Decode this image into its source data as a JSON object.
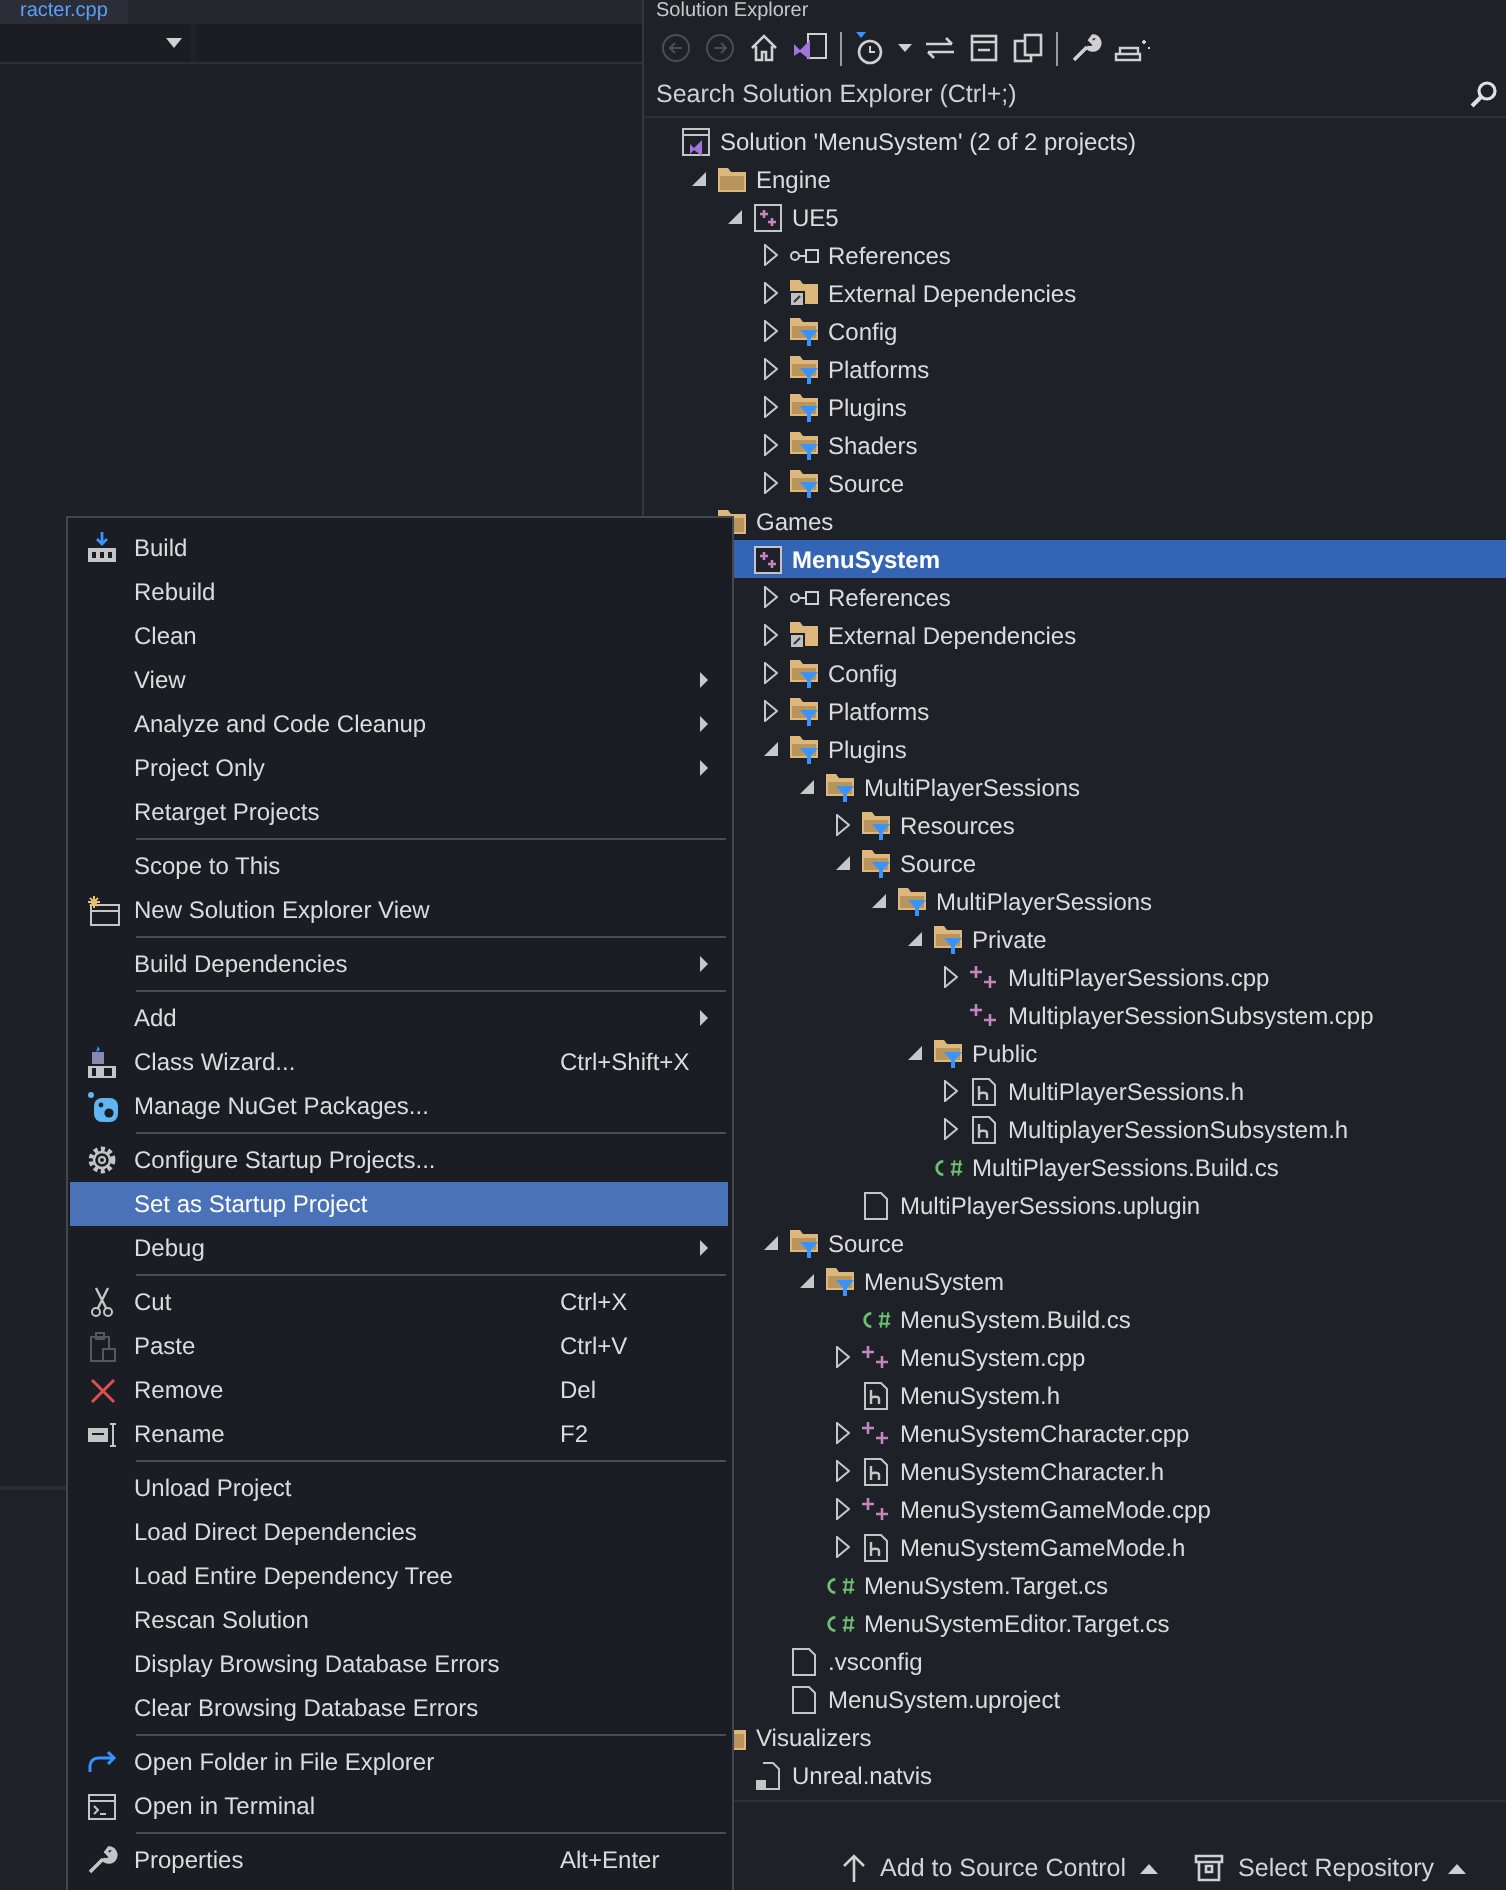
{
  "editor": {
    "tab": "racter.cpp"
  },
  "explorer": {
    "title": "Solution Explorer",
    "search": {
      "placeholder": "Search Solution Explorer (Ctrl+;)"
    },
    "tree": [
      {
        "label": "Solution 'MenuSystem' (2 of 2 projects)",
        "kind": "solution",
        "selected": false,
        "children": [
          {
            "label": "Engine",
            "kind": "folder",
            "expanded": true,
            "selected": false,
            "children": [
              {
                "label": "UE5",
                "kind": "project",
                "expanded": true,
                "selected": false,
                "children": [
                  {
                    "label": "References",
                    "kind": "references",
                    "expanded": false,
                    "selected": false
                  },
                  {
                    "label": "External Dependencies",
                    "kind": "deps",
                    "expanded": false,
                    "selected": false
                  },
                  {
                    "label": "Config",
                    "kind": "filter",
                    "expanded": false,
                    "selected": false
                  },
                  {
                    "label": "Platforms",
                    "kind": "filter",
                    "expanded": false,
                    "selected": false
                  },
                  {
                    "label": "Plugins",
                    "kind": "filter",
                    "expanded": false,
                    "selected": false
                  },
                  {
                    "label": "Shaders",
                    "kind": "filter",
                    "expanded": false,
                    "selected": false
                  },
                  {
                    "label": "Source",
                    "kind": "filter",
                    "expanded": false,
                    "selected": false
                  }
                ]
              }
            ]
          },
          {
            "label": "Games",
            "kind": "folder",
            "selected": false,
            "children": [
              {
                "label": "MenuSystem",
                "kind": "project",
                "selected": true,
                "children": [
                  {
                    "label": "References",
                    "kind": "references",
                    "expanded": false,
                    "selected": false
                  },
                  {
                    "label": "External Dependencies",
                    "kind": "deps",
                    "expanded": false,
                    "selected": false
                  },
                  {
                    "label": "Config",
                    "kind": "filter",
                    "expanded": false,
                    "selected": false
                  },
                  {
                    "label": "Platforms",
                    "kind": "filter",
                    "expanded": false,
                    "selected": false
                  },
                  {
                    "label": "Plugins",
                    "kind": "filter",
                    "expanded": true,
                    "selected": false,
                    "children": [
                      {
                        "label": "MultiPlayerSessions",
                        "kind": "filter",
                        "expanded": true,
                        "selected": false,
                        "children": [
                          {
                            "label": "Resources",
                            "kind": "filter",
                            "expanded": false,
                            "selected": false
                          },
                          {
                            "label": "Source",
                            "kind": "filter",
                            "expanded": true,
                            "selected": false,
                            "children": [
                              {
                                "label": "MultiPlayerSessions",
                                "kind": "filter",
                                "expanded": true,
                                "selected": false,
                                "children": [
                                  {
                                    "label": "Private",
                                    "kind": "filter",
                                    "expanded": true,
                                    "selected": false,
                                    "children": [
                                      {
                                        "label": "MultiPlayerSessions.cpp",
                                        "kind": "cpp",
                                        "expanded": false,
                                        "selected": false
                                      },
                                      {
                                        "label": "MultiplayerSessionSubsystem.cpp",
                                        "kind": "cpp",
                                        "selected": false
                                      }
                                    ]
                                  },
                                  {
                                    "label": "Public",
                                    "kind": "filter",
                                    "expanded": true,
                                    "selected": false,
                                    "children": [
                                      {
                                        "label": "MultiPlayerSessions.h",
                                        "kind": "h",
                                        "expanded": false,
                                        "selected": false
                                      },
                                      {
                                        "label": "MultiplayerSessionSubsystem.h",
                                        "kind": "h",
                                        "expanded": false,
                                        "selected": false
                                      }
                                    ]
                                  },
                                  {
                                    "label": "MultiPlayerSessions.Build.cs",
                                    "kind": "cs",
                                    "selected": false
                                  }
                                ]
                              }
                            ]
                          },
                          {
                            "label": "MultiPlayerSessions.uplugin",
                            "kind": "file",
                            "selected": false
                          }
                        ]
                      }
                    ]
                  },
                  {
                    "label": "Source",
                    "kind": "filter",
                    "expanded": true,
                    "selected": false,
                    "children": [
                      {
                        "label": "MenuSystem",
                        "kind": "filter",
                        "expanded": true,
                        "selected": false,
                        "children": [
                          {
                            "label": "MenuSystem.Build.cs",
                            "kind": "cs",
                            "selected": false
                          },
                          {
                            "label": "MenuSystem.cpp",
                            "kind": "cpp",
                            "expanded": false,
                            "selected": false
                          },
                          {
                            "label": "MenuSystem.h",
                            "kind": "h",
                            "selected": false
                          },
                          {
                            "label": "MenuSystemCharacter.cpp",
                            "kind": "cpp",
                            "expanded": false,
                            "selected": false
                          },
                          {
                            "label": "MenuSystemCharacter.h",
                            "kind": "h",
                            "expanded": false,
                            "selected": false
                          },
                          {
                            "label": "MenuSystemGameMode.cpp",
                            "kind": "cpp",
                            "expanded": false,
                            "selected": false
                          },
                          {
                            "label": "MenuSystemGameMode.h",
                            "kind": "h",
                            "expanded": false,
                            "selected": false
                          }
                        ]
                      },
                      {
                        "label": "MenuSystem.Target.cs",
                        "kind": "cs",
                        "selected": false
                      },
                      {
                        "label": "MenuSystemEditor.Target.cs",
                        "kind": "cs",
                        "selected": false
                      }
                    ]
                  },
                  {
                    "label": ".vsconfig",
                    "kind": "file",
                    "selected": false
                  },
                  {
                    "label": "MenuSystem.uproject",
                    "kind": "file",
                    "selected": false
                  }
                ]
              }
            ]
          },
          {
            "label": "Visualizers",
            "kind": "folder",
            "selected": false,
            "children": [
              {
                "label": "Unreal.natvis",
                "kind": "natvis",
                "selected": false
              }
            ]
          }
        ]
      }
    ]
  },
  "context_menu": [
    {
      "kind": "item",
      "label": "Build",
      "submenu": false,
      "selected": false
    },
    {
      "kind": "item",
      "label": "Rebuild",
      "submenu": false,
      "selected": false
    },
    {
      "kind": "item",
      "label": "Clean",
      "submenu": false,
      "selected": false
    },
    {
      "kind": "item",
      "label": "View",
      "submenu": true,
      "selected": false
    },
    {
      "kind": "item",
      "label": "Analyze and Code Cleanup",
      "submenu": true,
      "selected": false
    },
    {
      "kind": "item",
      "label": "Project Only",
      "submenu": true,
      "selected": false
    },
    {
      "kind": "item",
      "label": "Retarget Projects",
      "submenu": false,
      "selected": false
    },
    {
      "kind": "separator"
    },
    {
      "kind": "item",
      "label": "Scope to This",
      "submenu": false,
      "selected": false
    },
    {
      "kind": "item",
      "label": "New Solution Explorer View",
      "submenu": false,
      "selected": false
    },
    {
      "kind": "separator"
    },
    {
      "kind": "item",
      "label": "Build Dependencies",
      "submenu": true,
      "selected": false
    },
    {
      "kind": "separator"
    },
    {
      "kind": "item",
      "label": "Add",
      "submenu": true,
      "selected": false
    },
    {
      "kind": "item",
      "label": "Class Wizard...",
      "shortcut": "Ctrl+Shift+X",
      "submenu": false,
      "selected": false
    },
    {
      "kind": "item",
      "label": "Manage NuGet Packages...",
      "submenu": false,
      "selected": false
    },
    {
      "kind": "separator"
    },
    {
      "kind": "item",
      "label": "Configure Startup Projects...",
      "submenu": false,
      "selected": false
    },
    {
      "kind": "item",
      "label": "Set as Startup Project",
      "submenu": false,
      "selected": true
    },
    {
      "kind": "item",
      "label": "Debug",
      "submenu": true,
      "selected": false
    },
    {
      "kind": "separator"
    },
    {
      "kind": "item",
      "label": "Cut",
      "shortcut": "Ctrl+X",
      "submenu": false,
      "selected": false
    },
    {
      "kind": "item",
      "label": "Paste",
      "shortcut": "Ctrl+V",
      "submenu": false,
      "selected": false
    },
    {
      "kind": "item",
      "label": "Remove",
      "shortcut": "Del",
      "submenu": false,
      "selected": false
    },
    {
      "kind": "item",
      "label": "Rename",
      "shortcut": "F2",
      "submenu": false,
      "selected": false
    },
    {
      "kind": "separator"
    },
    {
      "kind": "item",
      "label": "Unload Project",
      "submenu": false,
      "selected": false
    },
    {
      "kind": "item",
      "label": "Load Direct Dependencies",
      "submenu": false,
      "selected": false
    },
    {
      "kind": "item",
      "label": "Load Entire Dependency Tree",
      "submenu": false,
      "selected": false
    },
    {
      "kind": "item",
      "label": "Rescan Solution",
      "submenu": false,
      "selected": false
    },
    {
      "kind": "item",
      "label": "Display Browsing Database Errors",
      "submenu": false,
      "selected": false
    },
    {
      "kind": "item",
      "label": "Clear Browsing Database Errors",
      "submenu": false,
      "selected": false
    },
    {
      "kind": "separator"
    },
    {
      "kind": "item",
      "label": "Open Folder in File Explorer",
      "submenu": false,
      "selected": false
    },
    {
      "kind": "item",
      "label": "Open in Terminal",
      "submenu": false,
      "selected": false
    },
    {
      "kind": "separator"
    },
    {
      "kind": "item",
      "label": "Properties",
      "shortcut": "Alt+Enter",
      "submenu": false,
      "selected": false
    }
  ],
  "status_bar": [
    {
      "label": "Add to Source Control"
    },
    {
      "label": "Select Repository"
    }
  ]
}
